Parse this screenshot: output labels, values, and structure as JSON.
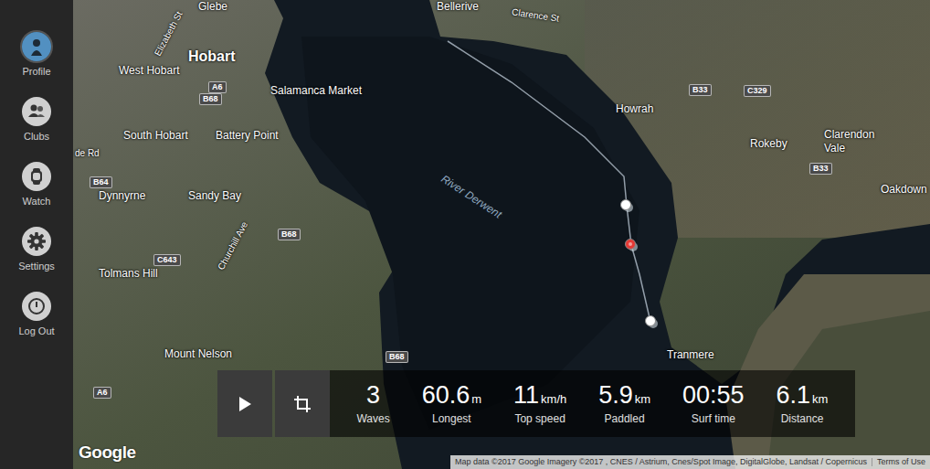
{
  "sidebar": {
    "items": [
      {
        "label": "Profile",
        "kind": "avatar"
      },
      {
        "label": "Clubs",
        "kind": "icon"
      },
      {
        "label": "Watch",
        "kind": "icon"
      },
      {
        "label": "Settings",
        "kind": "icon"
      },
      {
        "label": "Log Out",
        "kind": "icon"
      }
    ]
  },
  "map": {
    "labels": [
      {
        "text": "Glebe",
        "kind": "place"
      },
      {
        "text": "Bellerive",
        "kind": "place"
      },
      {
        "text": "Clarence St",
        "kind": "road"
      },
      {
        "text": "Elizabeth St",
        "kind": "road"
      },
      {
        "text": "Hobart",
        "kind": "city"
      },
      {
        "text": "West Hobart",
        "kind": "place"
      },
      {
        "text": "Salamanca Market",
        "kind": "place"
      },
      {
        "text": "A6",
        "kind": "shield"
      },
      {
        "text": "B68",
        "kind": "shield"
      },
      {
        "text": "South Hobart",
        "kind": "place"
      },
      {
        "text": "Battery Point",
        "kind": "place"
      },
      {
        "text": "Howrah",
        "kind": "place"
      },
      {
        "text": "B33",
        "kind": "shield"
      },
      {
        "text": "C329",
        "kind": "shield"
      },
      {
        "text": "Rokeby",
        "kind": "place"
      },
      {
        "text": "Clarendon Vale",
        "kind": "place"
      },
      {
        "text": "B33",
        "kind": "shield"
      },
      {
        "text": "Oakdown",
        "kind": "place"
      },
      {
        "text": "B64",
        "kind": "shield"
      },
      {
        "text": "de Rd",
        "kind": "road"
      },
      {
        "text": "Dynnyrne",
        "kind": "place"
      },
      {
        "text": "Sandy Bay",
        "kind": "place"
      },
      {
        "text": "River Derwent",
        "kind": "water"
      },
      {
        "text": "B68",
        "kind": "shield"
      },
      {
        "text": "Churchill Ave",
        "kind": "road"
      },
      {
        "text": "Tolmans Hill",
        "kind": "place"
      },
      {
        "text": "C643",
        "kind": "shield"
      },
      {
        "text": "Mount Nelson",
        "kind": "place"
      },
      {
        "text": "B68",
        "kind": "shield"
      },
      {
        "text": "A6",
        "kind": "shield"
      },
      {
        "text": "Tranmere",
        "kind": "place"
      }
    ],
    "markers": [
      {
        "color": "#ffffff"
      },
      {
        "color": "#e53935"
      },
      {
        "color": "#ffffff"
      }
    ],
    "logo": "Google",
    "attribution": "Map data ©2017 Google Imagery ©2017 , CNES / Astrium, Cnes/Spot Image, DigitalGlobe, Landsat / Copernicus",
    "terms": "Terms of Use"
  },
  "stats": [
    {
      "value": "3",
      "unit": "",
      "label": "Waves"
    },
    {
      "value": "60.6",
      "unit": "m",
      "label": "Longest"
    },
    {
      "value": "11",
      "unit": "km/h",
      "label": "Top speed"
    },
    {
      "value": "5.9",
      "unit": "km",
      "label": "Paddled"
    },
    {
      "value": "00:55",
      "unit": "",
      "label": "Surf time"
    },
    {
      "value": "6.1",
      "unit": "km",
      "label": "Distance"
    }
  ]
}
